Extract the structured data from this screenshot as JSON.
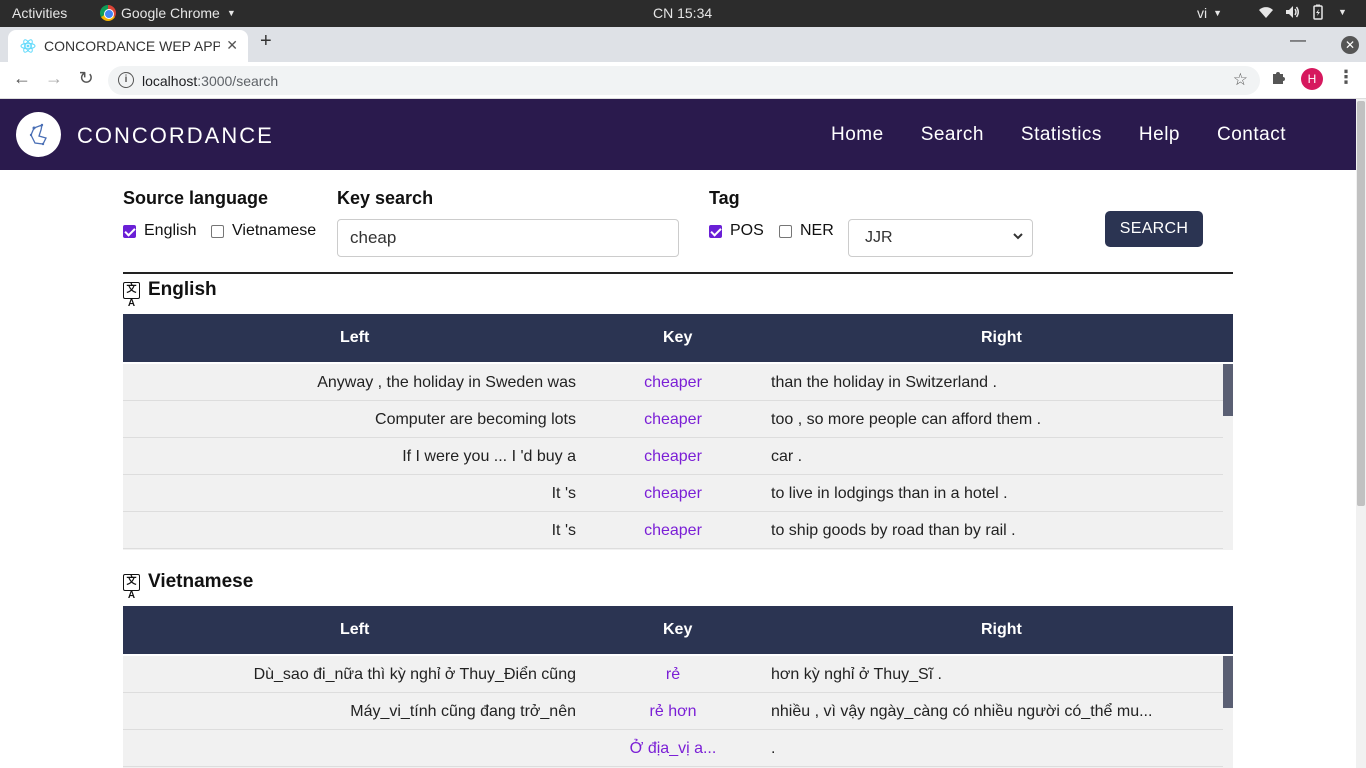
{
  "os": {
    "activities": "Activities",
    "app_name": "Google Chrome",
    "clock": "CN 15:34",
    "lang": "vi"
  },
  "browser": {
    "tab_title": "CONCORDANCE WEP APP",
    "url_host": "localhost",
    "url_path": ":3000/search",
    "profile_initial": "H"
  },
  "navbar": {
    "brand": "CONCORDANCE",
    "links": [
      "Home",
      "Search",
      "Statistics",
      "Help",
      "Contact"
    ]
  },
  "form": {
    "source_language_label": "Source language",
    "english_label": "English",
    "english_checked": true,
    "vietnamese_label": "Vietnamese",
    "vietnamese_checked": false,
    "key_search_label": "Key search",
    "key_search_value": "cheap",
    "tag_label": "Tag",
    "pos_label": "POS",
    "pos_checked": true,
    "ner_label": "NER",
    "ner_checked": false,
    "tag_select_value": "JJR",
    "search_button": "SEARCH"
  },
  "english": {
    "title": "English",
    "headers": {
      "left": "Left",
      "key": "Key",
      "right": "Right"
    },
    "rows": [
      {
        "left": "Anyway , the holiday in Sweden was",
        "key": "cheaper",
        "right": "than the holiday in Switzerland ."
      },
      {
        "left": "Computer are becoming lots",
        "key": "cheaper",
        "right": "too , so more people can afford them ."
      },
      {
        "left": "If I were you ... I 'd buy a",
        "key": "cheaper",
        "right": "car ."
      },
      {
        "left": "It 's",
        "key": "cheaper",
        "right": "to live in lodgings than in a hotel ."
      },
      {
        "left": "It 's",
        "key": "cheaper",
        "right": "to ship goods by road than by rail ."
      }
    ]
  },
  "vietnamese": {
    "title": "Vietnamese",
    "headers": {
      "left": "Left",
      "key": "Key",
      "right": "Right"
    },
    "rows": [
      {
        "left": "Dù_sao đi_nữa thì kỳ nghỉ ở Thuy_Điển cũng",
        "key": "rẻ",
        "right": "hơn kỳ nghỉ ở Thuy_Sĩ ."
      },
      {
        "left": "Máy_vi_tính cũng đang trở_nên",
        "key": "rẻ hơn",
        "right": "nhiều , vì vậy ngày_càng có nhiều người có_thể mu..."
      },
      {
        "left": "",
        "key": "Ở địa_vị a...",
        "right": "."
      }
    ]
  }
}
